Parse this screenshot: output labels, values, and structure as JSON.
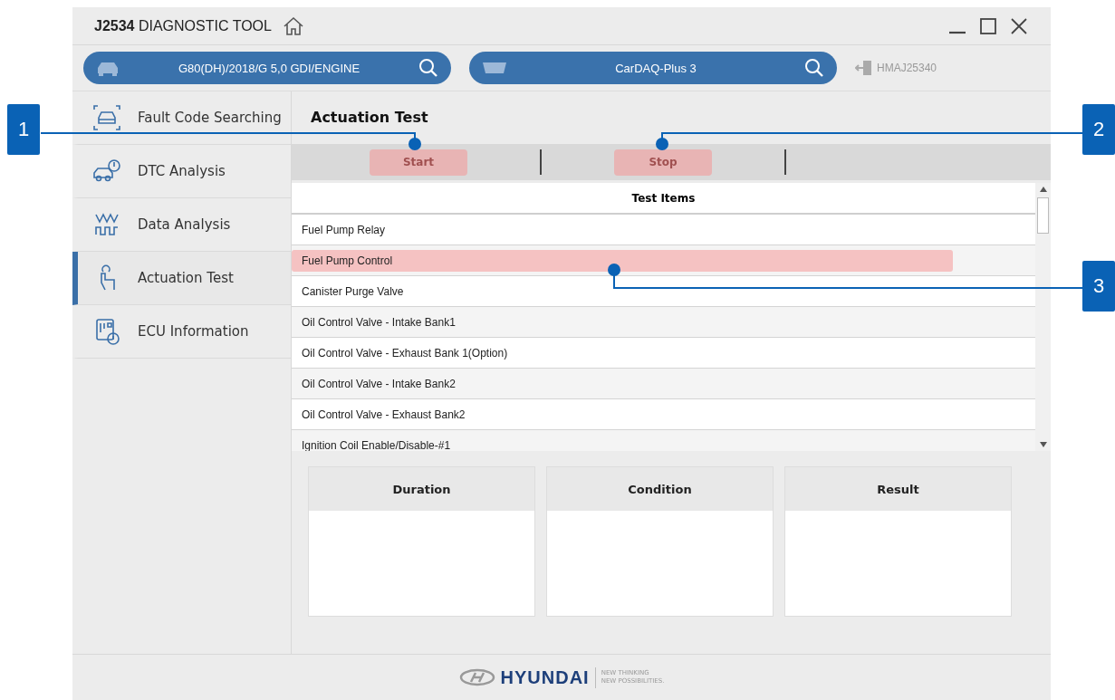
{
  "window": {
    "title_bold": "J2534",
    "title": "DIAGNOSTIC TOOL"
  },
  "vehicle_selector": {
    "value": "G80(DH)/2018/G 5,0 GDI/ENGINE"
  },
  "device_selector": {
    "value": "CarDAQ-Plus 3"
  },
  "user": {
    "id": "HMAJ25340"
  },
  "sidebar": {
    "items": [
      {
        "label": "Fault Code Searching",
        "selected": false
      },
      {
        "label": "DTC Analysis",
        "selected": false
      },
      {
        "label": "Data Analysis",
        "selected": false
      },
      {
        "label": "Actuation Test",
        "selected": true
      },
      {
        "label": "ECU Information",
        "selected": false
      }
    ]
  },
  "page_title": "Actuation Test",
  "toolbar": {
    "buttons": [
      {
        "label": "Start",
        "disabled": true
      },
      {
        "label": "Stop",
        "disabled": true
      }
    ]
  },
  "table": {
    "header": "Test Items",
    "rows": [
      {
        "label": "Fuel Pump Relay",
        "selected": false
      },
      {
        "label": "Fuel Pump Control",
        "selected": true
      },
      {
        "label": "Canister Purge Valve",
        "selected": false
      },
      {
        "label": "Oil Control Valve - Intake Bank1",
        "selected": false
      },
      {
        "label": "Oil Control Valve - Exhaust Bank 1(Option)",
        "selected": false
      },
      {
        "label": "Oil Control Valve - Intake Bank2",
        "selected": false
      },
      {
        "label": "Oil Control Valve - Exhaust Bank2",
        "selected": false
      },
      {
        "label": "Ignition Coil Enable/Disable-#1",
        "selected": false
      }
    ]
  },
  "panels": [
    {
      "title": "Duration"
    },
    {
      "title": "Condition"
    },
    {
      "title": "Result"
    }
  ],
  "footer": {
    "brand": "HYUNDAI",
    "tagline": [
      "NEW THINKING",
      "NEW POSSIBILITIES."
    ]
  },
  "callouts": [
    "1",
    "2",
    "3"
  ]
}
